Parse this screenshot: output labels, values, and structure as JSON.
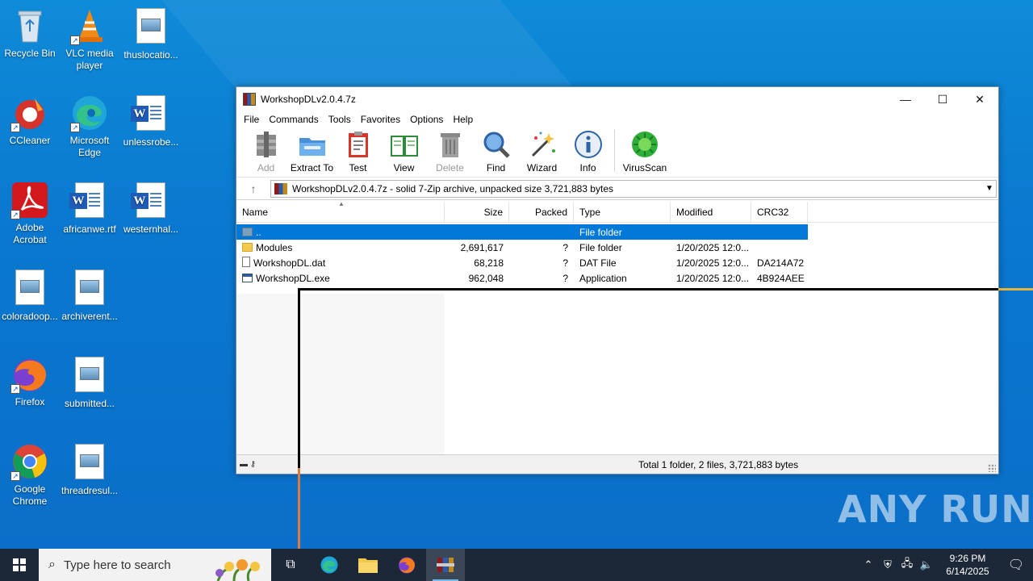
{
  "desktop": {
    "icons": [
      {
        "id": "recycle",
        "label": "Recycle Bin"
      },
      {
        "id": "vlc",
        "label": "VLC media player"
      },
      {
        "id": "thuslocation",
        "label": "thuslocatio..."
      },
      {
        "id": "ccleaner",
        "label": "CCleaner"
      },
      {
        "id": "edge",
        "label": "Microsoft Edge"
      },
      {
        "id": "unlessrobe",
        "label": "unlessrobe..."
      },
      {
        "id": "acrobat",
        "label": "Adobe Acrobat"
      },
      {
        "id": "africanwe",
        "label": "africanwe.rtf"
      },
      {
        "id": "westernhal",
        "label": "westernhal..."
      },
      {
        "id": "coloradoop",
        "label": "coloradoop..."
      },
      {
        "id": "archiverent",
        "label": "archiverent..."
      },
      {
        "id": "firefox",
        "label": "Firefox"
      },
      {
        "id": "submitted",
        "label": "submitted..."
      },
      {
        "id": "chrome",
        "label": "Google Chrome"
      },
      {
        "id": "threadresul",
        "label": "threadresul..."
      }
    ],
    "watermark": "ANY RUN"
  },
  "window": {
    "title": "WorkshopDLv2.0.4.7z",
    "menu": [
      "File",
      "Commands",
      "Tools",
      "Favorites",
      "Options",
      "Help"
    ],
    "toolbar": [
      {
        "label": "Add",
        "icon": "add-archive-icon",
        "disabled": true
      },
      {
        "label": "Extract To",
        "icon": "extract-folder-icon",
        "disabled": false
      },
      {
        "label": "Test",
        "icon": "test-clipboard-icon",
        "disabled": false
      },
      {
        "label": "View",
        "icon": "book-view-icon",
        "disabled": false
      },
      {
        "label": "Delete",
        "icon": "trash-icon",
        "disabled": true
      },
      {
        "label": "Find",
        "icon": "magnifier-icon",
        "disabled": false
      },
      {
        "label": "Wizard",
        "icon": "magic-wand-icon",
        "disabled": false
      },
      {
        "label": "Info",
        "icon": "info-icon",
        "disabled": false
      },
      {
        "label": "VirusScan",
        "icon": "virus-scan-icon",
        "disabled": false
      }
    ],
    "address": "WorkshopDLv2.0.4.7z - solid 7-Zip archive, unpacked size 3,721,883 bytes",
    "columns": [
      "Name",
      "Size",
      "Packed",
      "Type",
      "Modified",
      "CRC32"
    ],
    "rows": [
      {
        "name": "..",
        "size": "",
        "packed": "",
        "type": "File folder",
        "modified": "",
        "crc": "",
        "kind": "up",
        "selected": true
      },
      {
        "name": "Modules",
        "size": "2,691,617",
        "packed": "?",
        "type": "File folder",
        "modified": "1/20/2025 12:0...",
        "crc": "",
        "kind": "folder",
        "selected": false
      },
      {
        "name": "WorkshopDL.dat",
        "size": "68,218",
        "packed": "?",
        "type": "DAT File",
        "modified": "1/20/2025 12:0...",
        "crc": "DA214A72",
        "kind": "file",
        "selected": false
      },
      {
        "name": "WorkshopDL.exe",
        "size": "962,048",
        "packed": "?",
        "type": "Application",
        "modified": "1/20/2025 12:0...",
        "crc": "4B924AEE",
        "kind": "exe",
        "selected": false
      }
    ],
    "status": "Total 1 folder, 2 files, 3,721,883 bytes"
  },
  "taskbar": {
    "search_placeholder": "Type here to search",
    "time": "9:26 PM",
    "date": "6/14/2025"
  },
  "colors": {
    "accent": "#0078d7",
    "desktop": "#0a78cf",
    "taskbar": "#1c2838"
  }
}
